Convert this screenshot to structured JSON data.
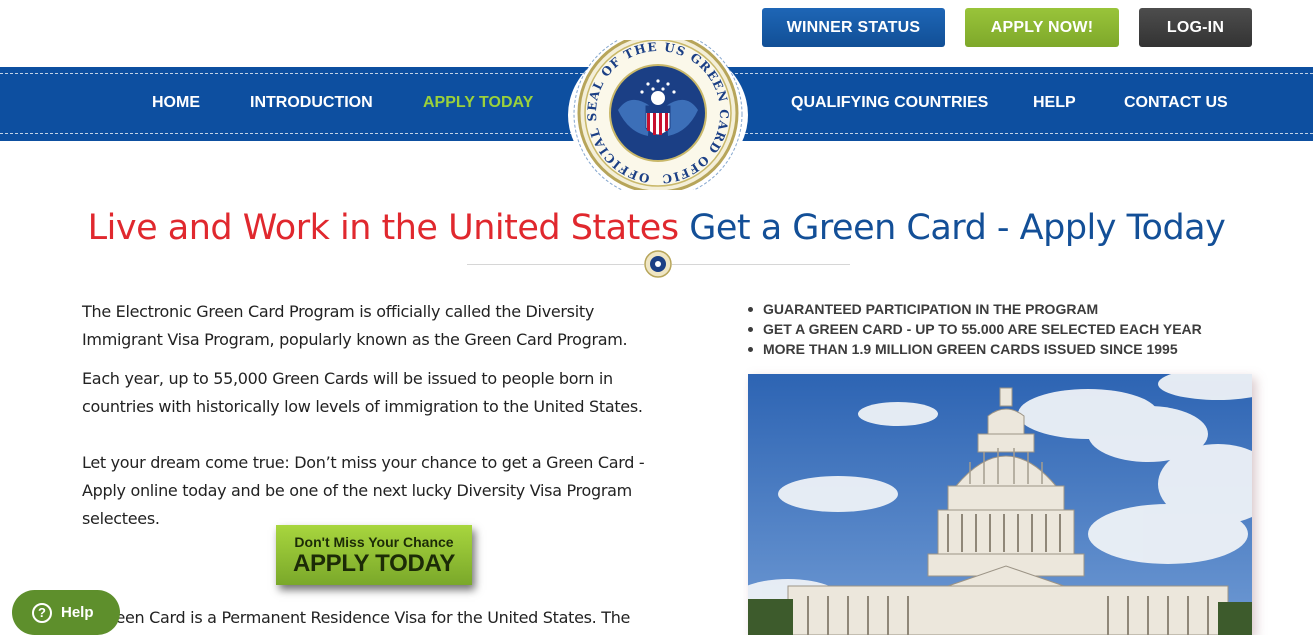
{
  "header": {
    "winner_status": "WINNER STATUS",
    "apply_now": "APPLY NOW!",
    "login": "LOG-IN"
  },
  "nav": {
    "items": [
      {
        "label": "HOME"
      },
      {
        "label": "INTRODUCTION"
      },
      {
        "label": "APPLY TODAY",
        "active": true
      },
      {
        "label": "QUALIFYING COUNTRIES"
      },
      {
        "label": "HELP"
      },
      {
        "label": "CONTACT US"
      }
    ]
  },
  "seal": {
    "text": "OFFICIAL SEAL OF THE US GREEN CARD OFFICE"
  },
  "headline": {
    "red": "Live and Work in the United States",
    "blue": "Get a Green Card - Apply Today"
  },
  "content": {
    "p1": "The Electronic Green Card Program is officially called the Diversity Immigrant Visa Program, popularly known as the Green Card Program.",
    "p2": "Each year, up to 55,000 Green Cards will be issued to people born in countries with historically low levels of immigration to the United States.",
    "p3": "Let your dream come true: Don’t miss your chance to get a Green Card - Apply online today and be one of the next lucky Diversity Visa Program selectees.",
    "p4": "A Green Card is a Permanent Residence Visa for the United States. The"
  },
  "cta": {
    "small": "Don't Miss Your Chance",
    "big": "APPLY TODAY"
  },
  "bullets": [
    "GUARANTEED PARTICIPATION IN THE PROGRAM",
    "GET A GREEN CARD - UP TO 55.000 ARE SELECTED EACH YEAR",
    "MORE THAN 1.9 MILLION GREEN CARDS ISSUED SINCE 1995"
  ],
  "help": {
    "icon": "question-icon",
    "label": "Help"
  },
  "colors": {
    "nav_blue": "#0d4fa0",
    "accent_green": "#9bd13b",
    "headline_red": "#e0282e",
    "headline_blue": "#134f97"
  }
}
